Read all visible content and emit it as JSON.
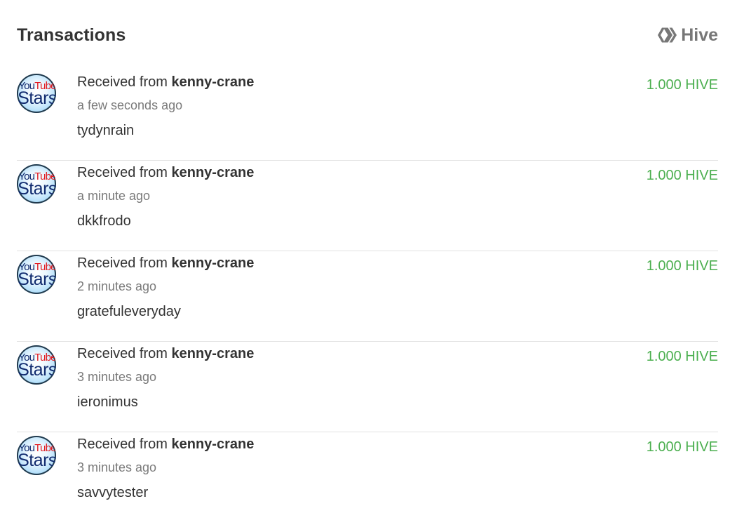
{
  "header": {
    "title": "Transactions",
    "brand": "Hive",
    "brand_icon": "hive-logo-icon"
  },
  "colors": {
    "amount": "#4caf50",
    "muted": "#7a7a7a",
    "text": "#333333",
    "divider": "#e2e2e2"
  },
  "avatar": {
    "line1_a": "You",
    "line1_b": "Tube",
    "line2": "Stars"
  },
  "transactions": [
    {
      "prefix": "Received from",
      "from": "kenny-crane",
      "time": "a few seconds ago",
      "memo": "tydynrain",
      "amount": "1.000 HIVE"
    },
    {
      "prefix": "Received from",
      "from": "kenny-crane",
      "time": "a minute ago",
      "memo": "dkkfrodo",
      "amount": "1.000 HIVE"
    },
    {
      "prefix": "Received from",
      "from": "kenny-crane",
      "time": "2 minutes ago",
      "memo": "gratefuleveryday",
      "amount": "1.000 HIVE"
    },
    {
      "prefix": "Received from",
      "from": "kenny-crane",
      "time": "3 minutes ago",
      "memo": "ieronimus",
      "amount": "1.000 HIVE"
    },
    {
      "prefix": "Received from",
      "from": "kenny-crane",
      "time": "3 minutes ago",
      "memo": "savvytester",
      "amount": "1.000 HIVE"
    }
  ]
}
